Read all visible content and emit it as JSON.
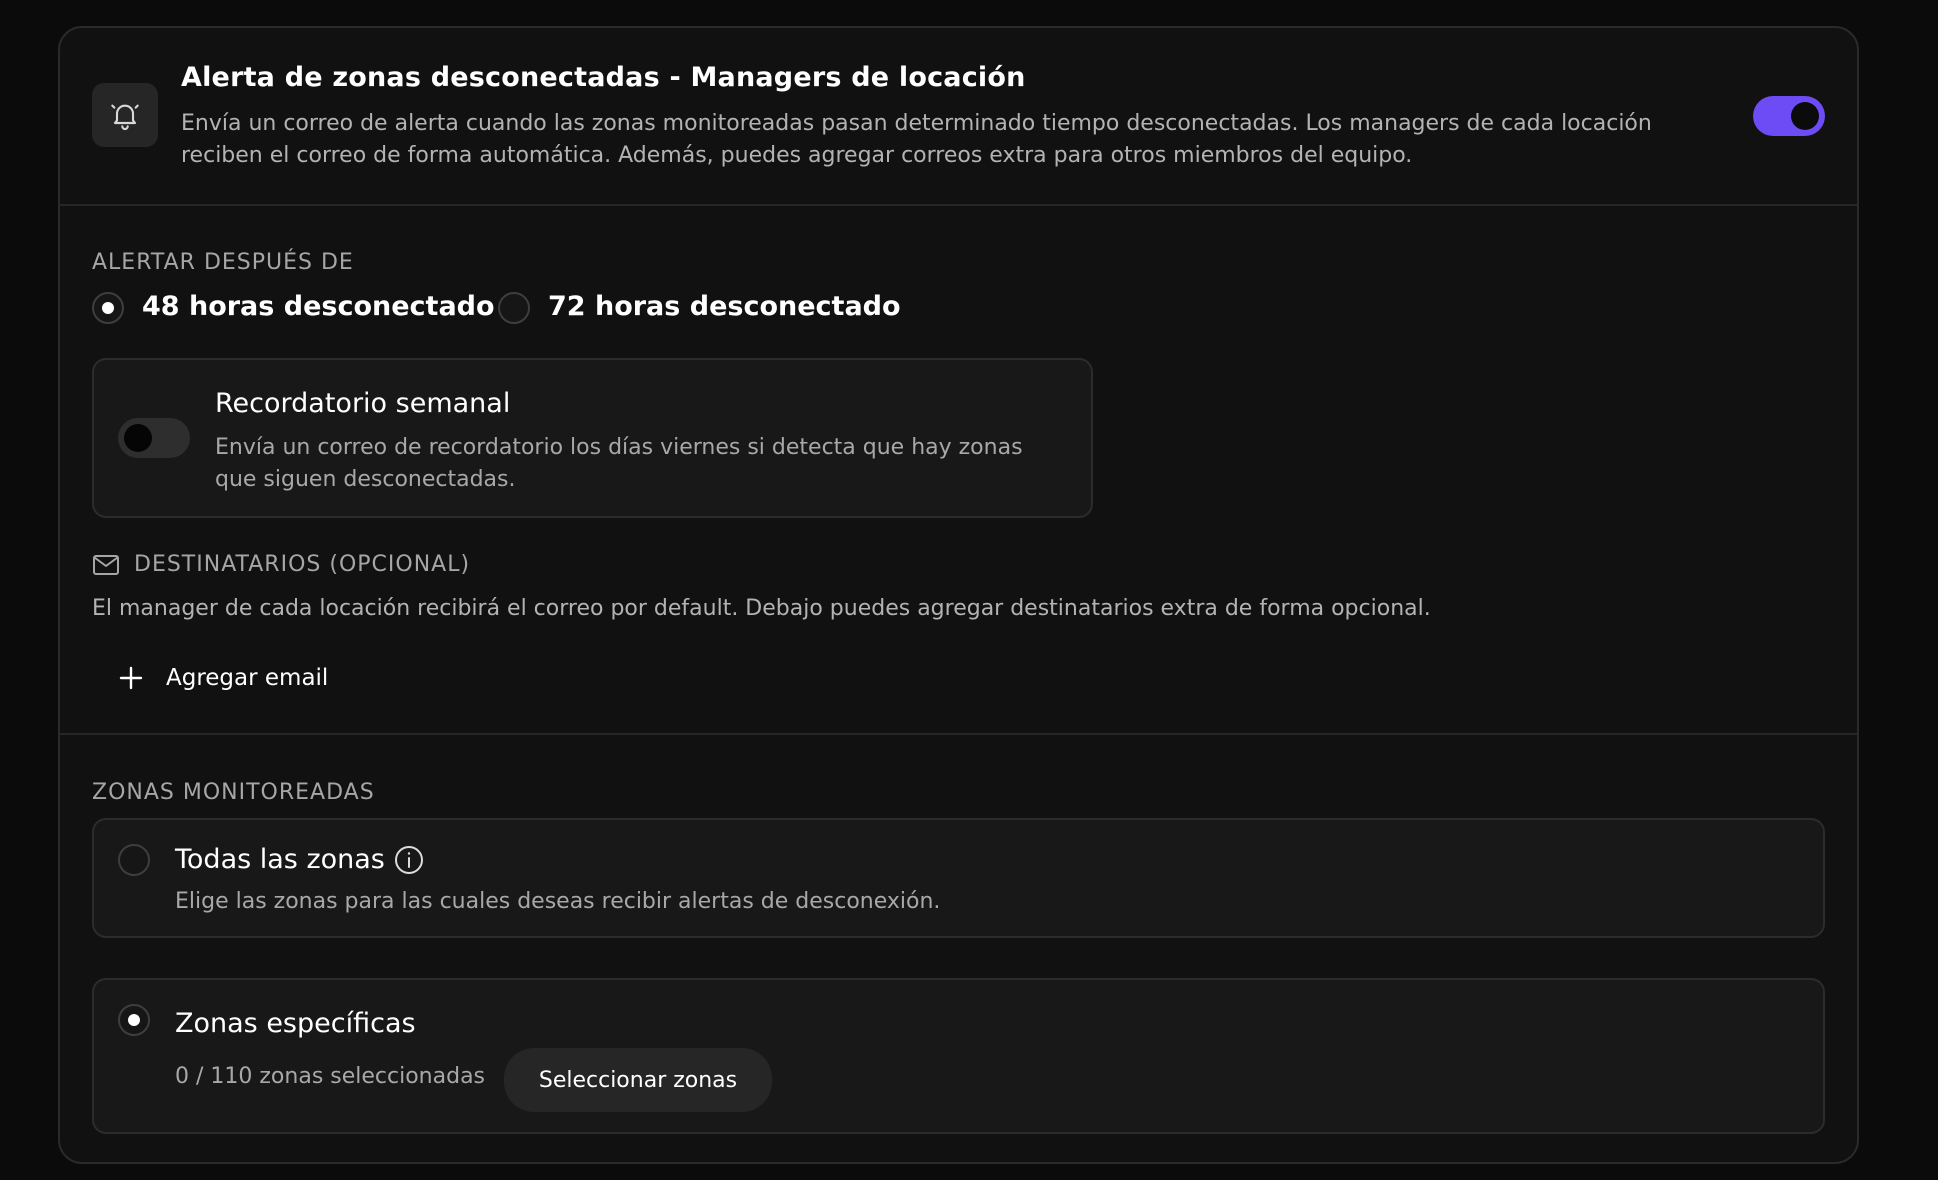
{
  "alert": {
    "title": "Alerta de zonas desconectadas - Managers de locación",
    "description": "Envía un correo de alerta cuando las zonas monitoreadas pasan determinado tiempo desconectadas. Los managers de cada locación reciben el correo de forma automática. Además, puedes agregar correos extra para otros miembros del equipo.",
    "enabled": true,
    "icon": "bell-icon",
    "accent_color": "#6d4cf6"
  },
  "alert_after": {
    "label": "ALERTAR DESPUÉS DE",
    "options": [
      {
        "label": "48 horas desconectado",
        "selected": true
      },
      {
        "label": "72 horas desconectado",
        "selected": false
      }
    ]
  },
  "weekly_reminder": {
    "title": "Recordatorio semanal",
    "description": "Envía un correo de recordatorio los días viernes si detecta que hay zonas que siguen desconectadas.",
    "enabled": false
  },
  "recipients": {
    "label": "DESTINATARIOS (OPCIONAL)",
    "icon": "mail-icon",
    "description": "El manager de cada locación recibirá el correo por default. Debajo puedes agregar destinatarios extra de forma opcional.",
    "add_label": "Agregar email"
  },
  "zones": {
    "label": "ZONAS MONITOREADAS",
    "all": {
      "title": "Todas las zonas",
      "description": "Elige las zonas para las cuales deseas recibir alertas de desconexión.",
      "selected": false
    },
    "specific": {
      "title": "Zonas específicas",
      "counter": "0 / 110 zonas seleccionadas",
      "button_label": "Seleccionar zonas",
      "selected": true
    }
  }
}
